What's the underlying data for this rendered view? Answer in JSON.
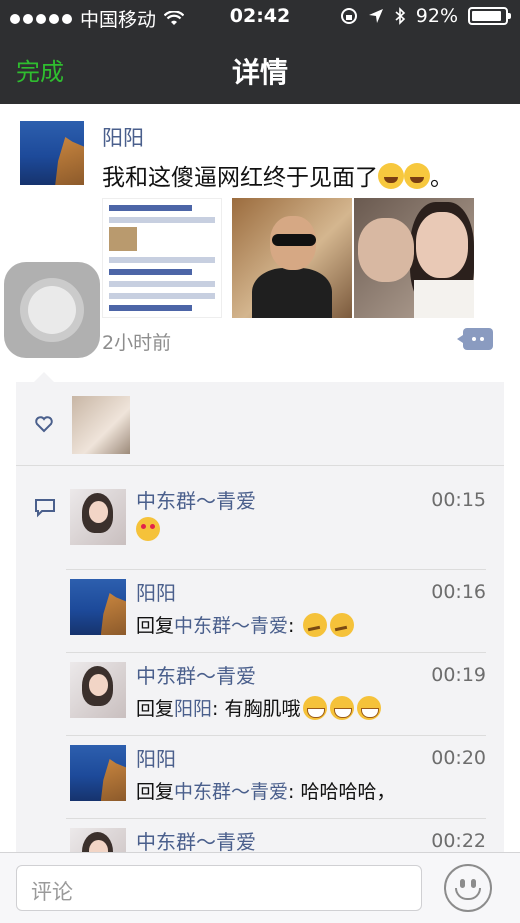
{
  "status_bar": {
    "carrier": "中国移动",
    "time": "02:42",
    "battery": "92%",
    "battery_level": 0.92
  },
  "nav": {
    "done_label": "完成",
    "title": "详情"
  },
  "post": {
    "author": "阳阳",
    "text": "我和这傻逼网红终于见面了",
    "time_ago": "2小时前",
    "images": [
      "screenshot-article",
      "man-sunglasses-selfie",
      "couple-selfie"
    ]
  },
  "likes": {
    "icon": "heart-icon"
  },
  "comments": [
    {
      "name": "中东群～青爱",
      "time": "00:15",
      "prefix": "",
      "reply_to": "",
      "text": "",
      "emojis": [
        "heart-eyes"
      ]
    },
    {
      "name": "阳阳",
      "time": "00:16",
      "prefix": "回复",
      "reply_to": "中东群～青爱",
      "text": ": ",
      "emojis": [
        "think",
        "think"
      ]
    },
    {
      "name": "中东群～青爱",
      "time": "00:19",
      "prefix": "回复",
      "reply_to": "阳阳",
      "text": ": 有胸肌哦",
      "emojis": [
        "grin",
        "grin",
        "grin"
      ]
    },
    {
      "name": "阳阳",
      "time": "00:20",
      "prefix": "回复",
      "reply_to": "中东群～青爱",
      "text": ": 哈哈哈哈，",
      "emojis": []
    },
    {
      "name": "中东群～青爱",
      "time": "00:22",
      "prefix": "",
      "reply_to": "",
      "text": "",
      "emojis": []
    }
  ],
  "input": {
    "placeholder": "评论"
  },
  "colors": {
    "bar": "#2e2f31",
    "done_green": "#2fbd2f",
    "link_blue": "#4a5f8c",
    "panel_bg": "#f3f3f5"
  }
}
